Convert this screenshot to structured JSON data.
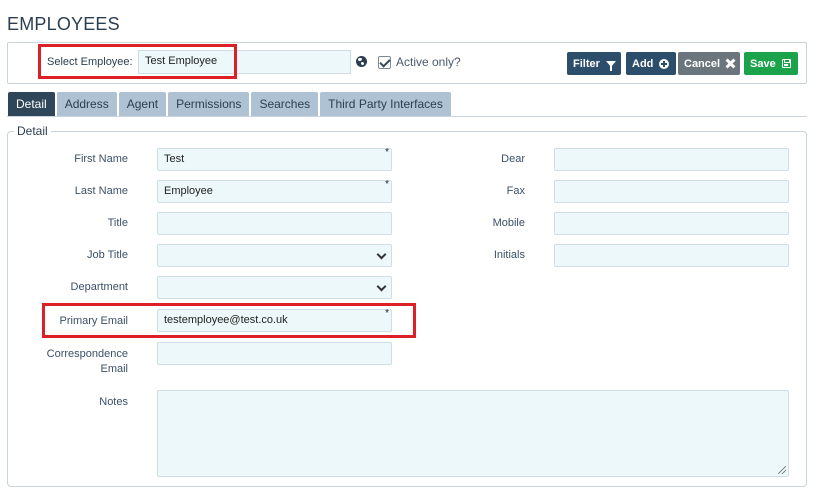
{
  "page": {
    "title": "EMPLOYEES"
  },
  "toolbar": {
    "select_label": "Select Employee:",
    "select_value": "Test Employee",
    "active_only_label": "Active only?",
    "active_only_checked": true,
    "filter_label": "Filter",
    "add_label": "Add",
    "cancel_label": "Cancel",
    "save_label": "Save"
  },
  "tabs": [
    {
      "label": "Detail",
      "active": true
    },
    {
      "label": "Address"
    },
    {
      "label": "Agent"
    },
    {
      "label": "Permissions"
    },
    {
      "label": "Searches"
    },
    {
      "label": "Third Party Interfaces"
    }
  ],
  "detail": {
    "legend": "Detail",
    "first_name": {
      "label": "First Name",
      "value": "Test",
      "required": "*"
    },
    "last_name": {
      "label": "Last Name",
      "value": "Employee",
      "required": "*"
    },
    "title": {
      "label": "Title",
      "value": ""
    },
    "job_title": {
      "label": "Job Title",
      "value": ""
    },
    "department": {
      "label": "Department",
      "value": ""
    },
    "primary_email": {
      "label": "Primary Email",
      "value": "testemployee@test.co.uk",
      "required": "*"
    },
    "correspondence_email": {
      "label_1": "Correspondence",
      "label_2": "Email",
      "value": ""
    },
    "notes": {
      "label": "Notes",
      "value": ""
    },
    "dear": {
      "label": "Dear",
      "value": ""
    },
    "fax": {
      "label": "Fax",
      "value": ""
    },
    "mobile": {
      "label": "Mobile",
      "value": ""
    },
    "initials": {
      "label": "Initials",
      "value": ""
    }
  },
  "colors": {
    "primary_button": "#2d4e6b",
    "cancel_button": "#6a757d",
    "save_button": "#1aa34a",
    "highlight": "#dd1f26",
    "active_tab": "#2f4659",
    "inactive_tab": "#aec2d3",
    "input_bg": "#edf8fb"
  },
  "icons": {
    "filter": "funnel-icon",
    "add": "plus-circle-icon",
    "cancel": "close-icon",
    "save": "floppy-disk-icon",
    "globe": "globe-icon"
  }
}
